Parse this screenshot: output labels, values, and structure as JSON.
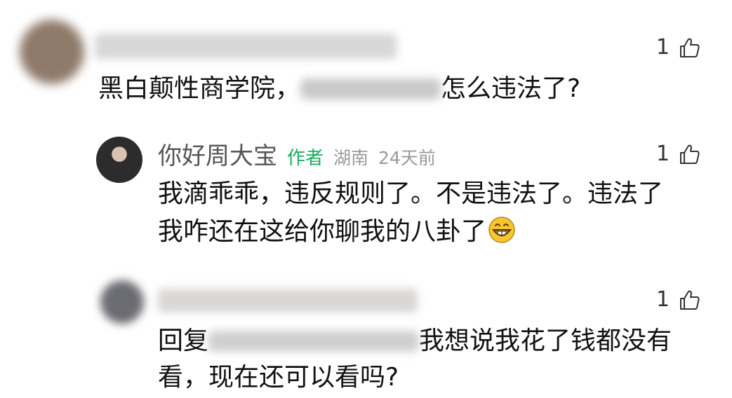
{
  "comments": [
    {
      "text_prefix": "黑白颠性商学院，",
      "text_suffix": "怎么违法了?",
      "likes": "1"
    },
    {
      "username": "你好周大宝",
      "author_tag": "作者",
      "location": "湖南",
      "time": "24天前",
      "text_line1": "我滴乖乖，违反规则了。不是违法了。违法了",
      "text_line2": "我咋还在这给你聊我的八卦了",
      "emoji": "grinning-face-icon",
      "likes": "1"
    },
    {
      "text_prefix": "回复",
      "text_line1_suffix": "我想说我花了钱都没有",
      "text_line2": "看，现在还可以看吗?",
      "likes": "1"
    }
  ],
  "colors": {
    "author_green": "#1aad5b",
    "meta_gray": "#9a9a9a",
    "username_gray": "#555555"
  }
}
